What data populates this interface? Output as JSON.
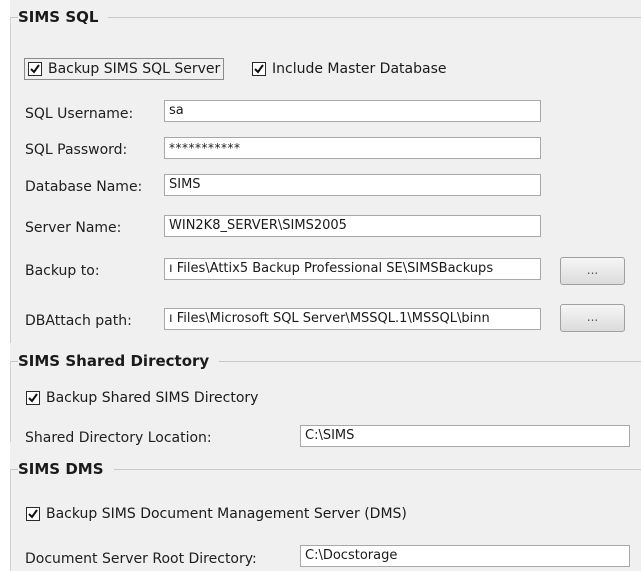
{
  "sims_sql": {
    "title": "SIMS SQL",
    "backup_server": {
      "label": "Backup SIMS SQL Server",
      "checked": true
    },
    "include_master": {
      "label": "Include Master Database",
      "checked": true
    },
    "username_label": "SQL Username:",
    "username_value": "sa",
    "password_label": "SQL Password:",
    "password_value": "***********",
    "dbname_label": "Database Name:",
    "dbname_value": "SIMS",
    "servername_label": "Server Name:",
    "servername_value": "WIN2K8_SERVER\\SIMS2005",
    "backupto_label": "Backup to:",
    "backupto_value": "ı Files\\Attix5 Backup Professional SE\\SIMSBackups",
    "backupto_browse": "...",
    "dbattach_label": "DBAttach path:",
    "dbattach_value": "ı Files\\Microsoft SQL Server\\MSSQL.1\\MSSQL\\binn",
    "dbattach_browse": "..."
  },
  "shared_dir": {
    "title": "SIMS Shared Directory",
    "backup_shared": {
      "label": "Backup Shared SIMS Directory",
      "checked": true
    },
    "location_label": "Shared Directory Location:",
    "location_value": "C:\\SIMS"
  },
  "dms": {
    "title": "SIMS DMS",
    "backup_dms": {
      "label": "Backup SIMS Document Management Server (DMS)",
      "checked": true
    },
    "root_label": "Document Server Root Directory:",
    "root_value": "C:\\Docstorage"
  }
}
